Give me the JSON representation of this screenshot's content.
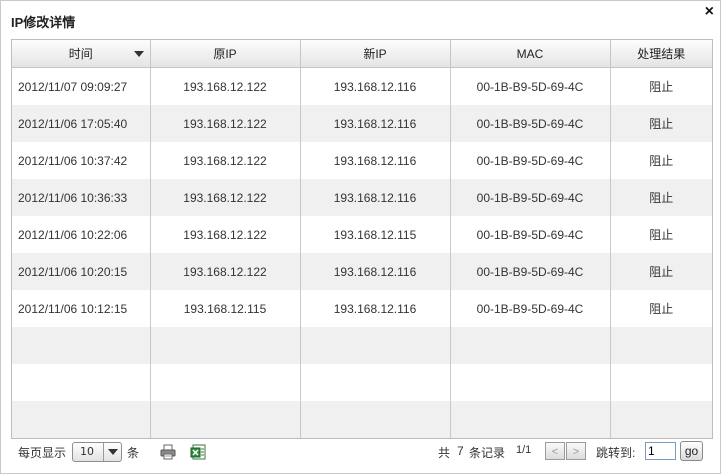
{
  "dialog": {
    "title": "IP修改详情",
    "close_label": "×"
  },
  "columns": [
    "时间",
    "原IP",
    "新IP",
    "MAC",
    "处理结果"
  ],
  "rows": [
    {
      "time": "2012/11/07 09:09:27",
      "old_ip": "193.168.12.122",
      "new_ip": "193.168.12.116",
      "mac": "00-1B-B9-5D-69-4C",
      "result": "阻止"
    },
    {
      "time": "2012/11/06 17:05:40",
      "old_ip": "193.168.12.122",
      "new_ip": "193.168.12.116",
      "mac": "00-1B-B9-5D-69-4C",
      "result": "阻止"
    },
    {
      "time": "2012/11/06 10:37:42",
      "old_ip": "193.168.12.122",
      "new_ip": "193.168.12.116",
      "mac": "00-1B-B9-5D-69-4C",
      "result": "阻止"
    },
    {
      "time": "2012/11/06 10:36:33",
      "old_ip": "193.168.12.122",
      "new_ip": "193.168.12.116",
      "mac": "00-1B-B9-5D-69-4C",
      "result": "阻止"
    },
    {
      "time": "2012/11/06 10:22:06",
      "old_ip": "193.168.12.122",
      "new_ip": "193.168.12.115",
      "mac": "00-1B-B9-5D-69-4C",
      "result": "阻止"
    },
    {
      "time": "2012/11/06 10:20:15",
      "old_ip": "193.168.12.122",
      "new_ip": "193.168.12.116",
      "mac": "00-1B-B9-5D-69-4C",
      "result": "阻止"
    },
    {
      "time": "2012/11/06 10:12:15",
      "old_ip": "193.168.12.115",
      "new_ip": "193.168.12.116",
      "mac": "00-1B-B9-5D-69-4C",
      "result": "阻止"
    }
  ],
  "footer": {
    "per_page_label": "每页显示",
    "page_size": "10",
    "unit_label": "条",
    "print_icon": "printer-icon",
    "export_icon": "excel-export-icon",
    "total_prefix": "共",
    "total_count": "7",
    "total_suffix": "条记录",
    "page_indicator": "1/1",
    "prev_label": "<",
    "next_label": ">",
    "jump_label": "跳转到:",
    "jump_value": "1",
    "go_label": "go"
  }
}
